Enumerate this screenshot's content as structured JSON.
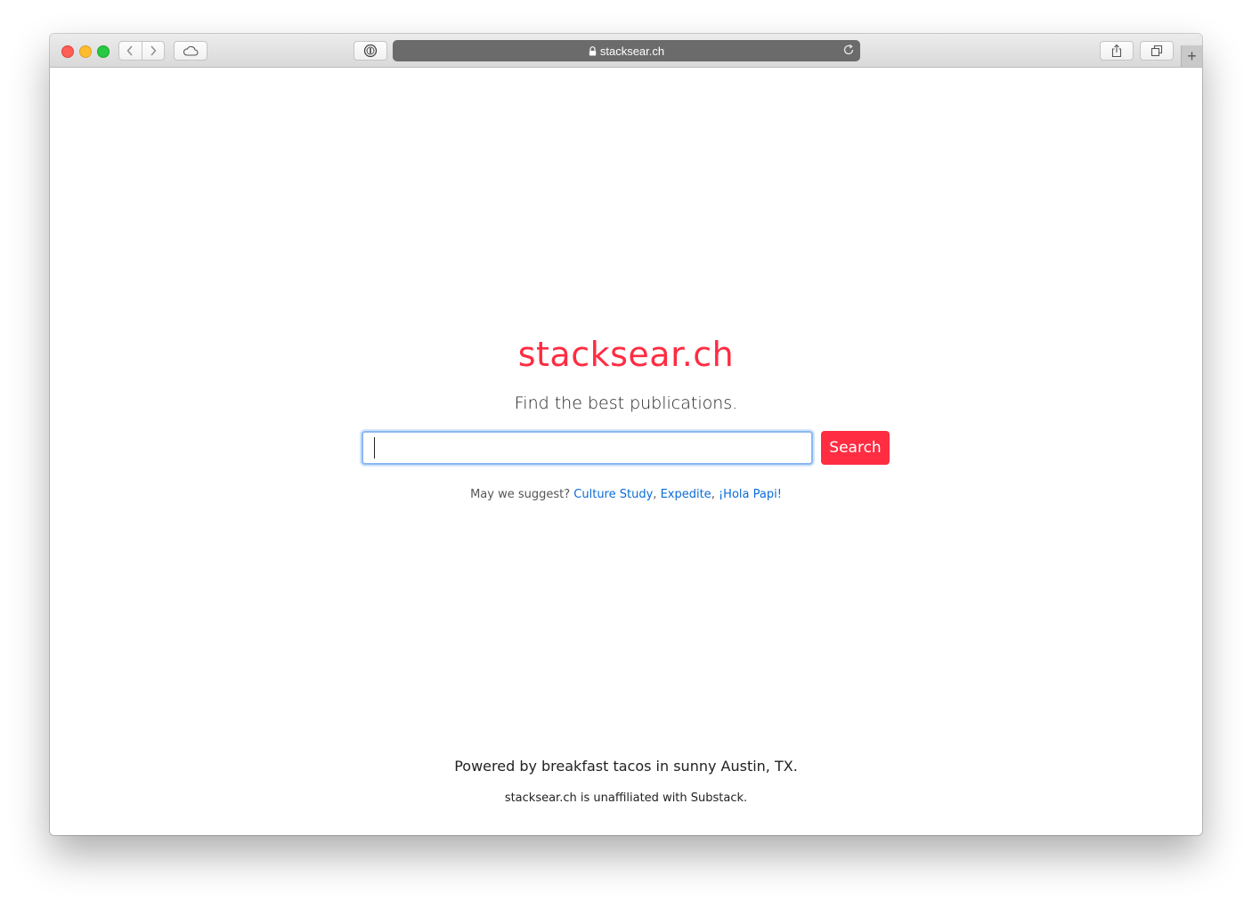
{
  "browser": {
    "url": "stacksear.ch",
    "icons": {
      "back": "chevron-left-icon",
      "forward": "chevron-right-icon",
      "cloud": "icloud-tabs-icon",
      "password": "password-manager-icon",
      "lock": "lock-icon",
      "reload": "reload-icon",
      "share": "share-icon",
      "tabs": "tab-overview-icon",
      "new_tab": "plus-icon"
    }
  },
  "page": {
    "brand": "stacksear.ch",
    "tagline": "Find the best publications.",
    "search": {
      "value": "",
      "button_label": "Search"
    },
    "suggest": {
      "prefix": "May we suggest?",
      "links": [
        "Culture Study",
        "Expedite",
        "¡Hola Papi!"
      ],
      "separator": ", "
    },
    "footer": {
      "powered_by": "Powered by breakfast tacos in sunny Austin, TX.",
      "disclaimer": "stacksear.ch is unaffiliated with Substack."
    }
  },
  "colors": {
    "brand": "#ff2c42",
    "link": "#0a6cd8",
    "focus_ring": "#89b8f2"
  }
}
